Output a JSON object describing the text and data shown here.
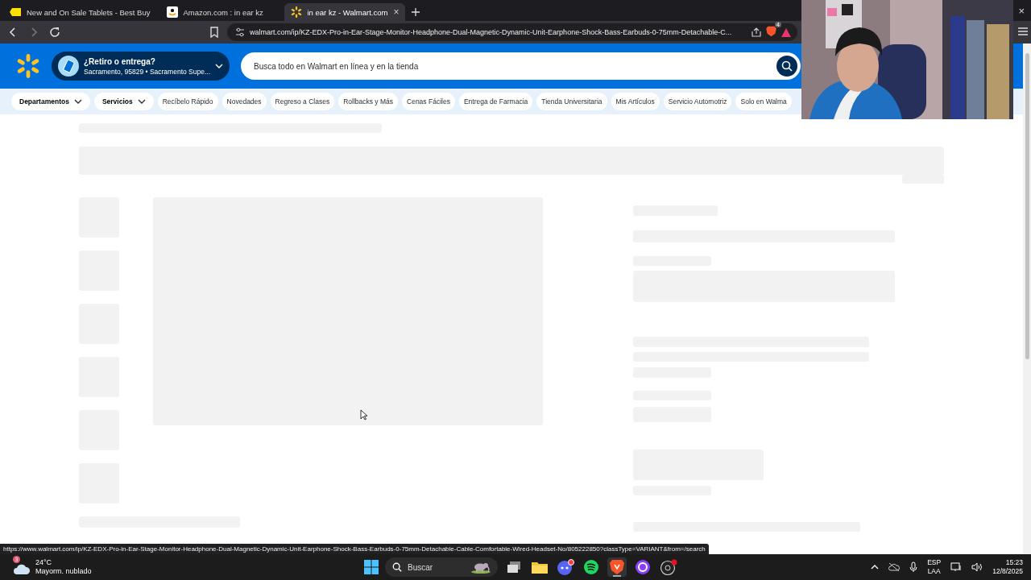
{
  "browser": {
    "tabs": [
      {
        "title": "New and On Sale Tablets - Best Buy",
        "kind": "tag",
        "selected": false
      },
      {
        "title": "Amazon.com : in ear kz",
        "kind": "smile",
        "selected": false
      },
      {
        "title": "in ear kz - Walmart.com",
        "kind": "spark",
        "selected": true
      }
    ],
    "close_tab": "×",
    "close_window": "×",
    "address": "walmart.com/ip/KZ-EDX-Pro-in-Ear-Stage-Monitor-Headphone-Dual-Magnetic-Dynamic-Unit-Earphone-Shock-Bass-Earbuds-0-75mm-Detachable-C...",
    "shield_badge": "4",
    "status_url": "https://www.walmart.com/ip/KZ-EDX-Pro-in-Ear-Stage-Monitor-Headphone-Dual-Magnetic-Dynamic-Unit-Earphone-Shock-Bass-Earbuds-0-75mm-Detachable-Cable-Comfortable-Wired-Headset-No/805222850?classType=VARIANT&from=/search"
  },
  "header": {
    "delivery_title": "¿Retiro o entrega?",
    "delivery_location": "Sacramento, 95829 • Sacramento Supe...",
    "search": {
      "placeholder": "Busca todo en Walmart en línea y en la tienda"
    }
  },
  "nav": [
    {
      "label": "Departamentos",
      "dropdown": true
    },
    {
      "label": "Servicios",
      "dropdown": true
    },
    {
      "label": "Recíbelo Rápido",
      "dropdown": false
    },
    {
      "label": "Novedades",
      "dropdown": false
    },
    {
      "label": "Regreso a Clases",
      "dropdown": false
    },
    {
      "label": "Rollbacks y Más",
      "dropdown": false
    },
    {
      "label": "Cenas Fáciles",
      "dropdown": false
    },
    {
      "label": "Entrega de Farmacia",
      "dropdown": false
    },
    {
      "label": "Tienda Universitaria",
      "dropdown": false
    },
    {
      "label": "Mis Artículos",
      "dropdown": false
    },
    {
      "label": "Servicio Automotriz",
      "dropdown": false
    },
    {
      "label": "Solo en Walma",
      "dropdown": false
    }
  ],
  "taskbar": {
    "weather_badge": "3",
    "temperature": "24°C",
    "weather": "Mayorm. nublado",
    "search": {
      "placeholder": "Buscar"
    },
    "apps": [
      {
        "kind": "taskview",
        "selected": false
      },
      {
        "kind": "files",
        "selected": false
      },
      {
        "kind": "discord",
        "selected": false
      },
      {
        "kind": "spotify",
        "selected": false
      },
      {
        "kind": "brave",
        "selected": true
      },
      {
        "kind": "circle",
        "selected": false
      },
      {
        "kind": "obs",
        "selected": false
      }
    ],
    "language": "ESP",
    "layout": "LAA",
    "time": "15:23",
    "date": "12/8/2025"
  }
}
